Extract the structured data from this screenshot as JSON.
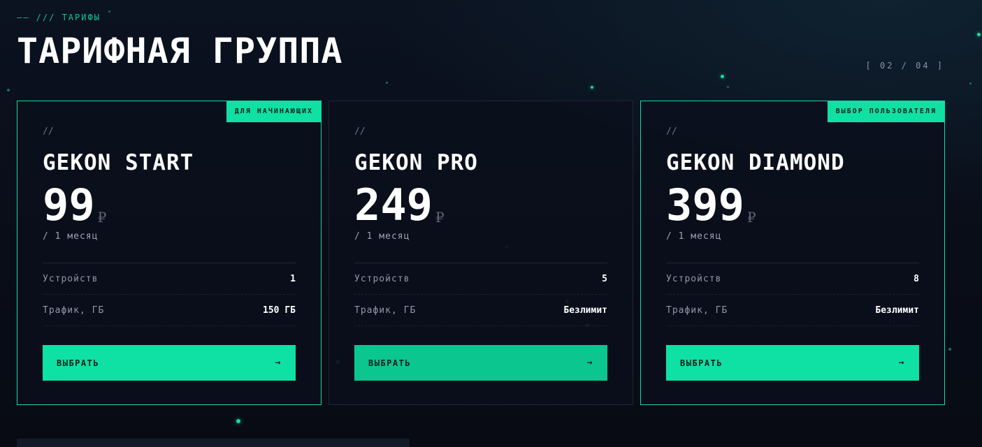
{
  "header": {
    "eyebrow": "—— /// ТАРИФЫ",
    "title": "ТАРИФНАЯ ГРУППА",
    "pager": "[ 02 / 04 ]"
  },
  "plans": [
    {
      "badge": "ДЛЯ НАЧИНАЮЩИХ",
      "slashes": "//",
      "name": "GEKON START",
      "price": "99",
      "currency": "₽",
      "period": "/ 1 месяц",
      "features": [
        {
          "label": "Устройств",
          "value": "1"
        },
        {
          "label": "Трафик, ГБ",
          "value": "150 ГБ"
        }
      ],
      "button_label": "ВЫБРАТЬ",
      "button_arrow": "→"
    },
    {
      "badge": "",
      "slashes": "//",
      "name": "GEKON PRO",
      "price": "249",
      "currency": "₽",
      "period": "/ 1 месяц",
      "features": [
        {
          "label": "Устройств",
          "value": "5"
        },
        {
          "label": "Трафик, ГБ",
          "value": "Безлимит"
        }
      ],
      "button_label": "ВЫБРАТЬ",
      "button_arrow": "→"
    },
    {
      "badge": "ВЫБОР ПОЛЬЗОВАТЕЛЯ",
      "slashes": "//",
      "name": "GEKON DIAMOND",
      "price": "399",
      "currency": "₽",
      "period": "/ 1 месяц",
      "features": [
        {
          "label": "Устройств",
          "value": "8"
        },
        {
          "label": "Трафик, ГБ",
          "value": "Безлимит"
        }
      ],
      "button_label": "ВЫБРАТЬ",
      "button_arrow": "→"
    }
  ],
  "colors": {
    "accent": "#0fe0a4",
    "background": "#0b1220",
    "card_border": "#1e2536"
  },
  "icons": {
    "button_arrow": "arrow-right-icon",
    "currency": "ruble-icon"
  }
}
